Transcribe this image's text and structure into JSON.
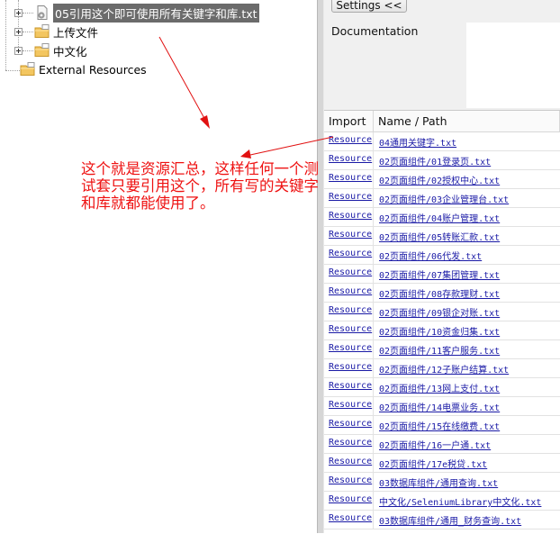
{
  "tree": {
    "items": [
      {
        "label": "05引用这个即可使用所有关键字和库.txt",
        "icon": "gear-file-icon",
        "selected": true
      },
      {
        "label": "上传文件",
        "icon": "folder-icon",
        "selected": false
      },
      {
        "label": "中文化",
        "icon": "folder-icon",
        "selected": false
      },
      {
        "label": "External Resources",
        "icon": "folder-icon",
        "selected": false
      }
    ]
  },
  "right": {
    "settings_label": "Settings <<",
    "documentation_label": "Documentation",
    "columns": {
      "import": "Import",
      "name": "Name / Path"
    },
    "rows": [
      {
        "import": "Resource",
        "name": "04通用关键字.txt"
      },
      {
        "import": "Resource",
        "name": "02页面组件/01登录页.txt"
      },
      {
        "import": "Resource",
        "name": "02页面组件/02授权中心.txt"
      },
      {
        "import": "Resource",
        "name": "02页面组件/03企业管理台.txt"
      },
      {
        "import": "Resource",
        "name": "02页面组件/04账户管理.txt"
      },
      {
        "import": "Resource",
        "name": "02页面组件/05转账汇款.txt"
      },
      {
        "import": "Resource",
        "name": "02页面组件/06代发.txt"
      },
      {
        "import": "Resource",
        "name": "02页面组件/07集团管理.txt"
      },
      {
        "import": "Resource",
        "name": "02页面组件/08存款理财.txt"
      },
      {
        "import": "Resource",
        "name": "02页面组件/09银企对账.txt"
      },
      {
        "import": "Resource",
        "name": "02页面组件/10资金归集.txt"
      },
      {
        "import": "Resource",
        "name": "02页面组件/11客户服务.txt"
      },
      {
        "import": "Resource",
        "name": "02页面组件/12子账户结算.txt"
      },
      {
        "import": "Resource",
        "name": "02页面组件/13网上支付.txt"
      },
      {
        "import": "Resource",
        "name": "02页面组件/14电票业务.txt"
      },
      {
        "import": "Resource",
        "name": "02页面组件/15在线缴费.txt"
      },
      {
        "import": "Resource",
        "name": "02页面组件/16一户通.txt"
      },
      {
        "import": "Resource",
        "name": "02页面组件/17e税贷.txt"
      },
      {
        "import": "Resource",
        "name": "03数据库组件/通用查询.txt"
      },
      {
        "import": "Resource",
        "name": "中文化/SeleniumLibrary中文化.txt"
      },
      {
        "import": "Resource",
        "name": "03数据库组件/通用_财务查询.txt"
      }
    ]
  },
  "annotation": {
    "text": "这个就是资源汇总，这样任何一个测试套只要引用这个，所有写的关键字和库就都能使用了。",
    "color": "#e11111"
  }
}
